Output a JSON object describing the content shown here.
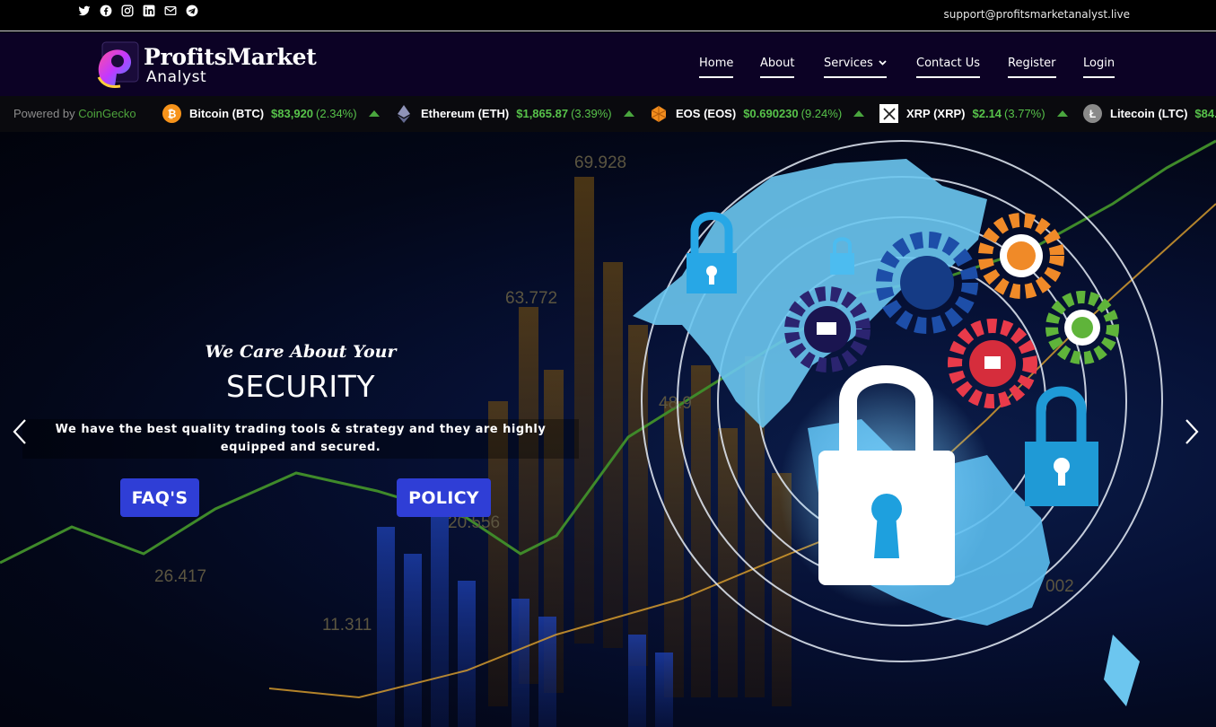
{
  "topbar": {
    "socials": [
      {
        "icon": "twitter-icon"
      },
      {
        "icon": "facebook-icon"
      },
      {
        "icon": "instagram-icon"
      },
      {
        "icon": "linkedin-icon"
      },
      {
        "icon": "mail-icon"
      },
      {
        "icon": "telegram-icon"
      }
    ],
    "email": "support@profitsmarketanalyst.live"
  },
  "header": {
    "logo_line1": "ProfitsMarket",
    "logo_line2": "Analyst",
    "nav": [
      {
        "label": "Home"
      },
      {
        "label": "About"
      },
      {
        "label": "Services"
      },
      {
        "label": "Contact Us"
      },
      {
        "label": "Register"
      },
      {
        "label": "Login"
      }
    ]
  },
  "ticker": {
    "powered_prefix": "Powered by ",
    "powered_brand": "CoinGecko",
    "coins": [
      {
        "name": "Bitcoin (BTC)",
        "price": "$83,920",
        "change": "(2.34%)",
        "color": "#f7931a"
      },
      {
        "name": "Ethereum (ETH)",
        "price": "$1,865.87",
        "change": "(3.39%)",
        "color": "#8c8c9e"
      },
      {
        "name": "EOS (EOS)",
        "price": "$0.690230",
        "change": "(9.24%)",
        "color": "#f08a1c"
      },
      {
        "name": "XRP (XRP)",
        "price": "$2.14",
        "change": "(3.77%)",
        "color": "#ffffff"
      },
      {
        "name": "Litecoin (LTC)",
        "price": "$84.",
        "change": "",
        "color": "#8a8a8a"
      }
    ]
  },
  "hero": {
    "subtitle": "We Care About Your",
    "title": "SECURITY",
    "text": "We have the best quality trading tools & strategy and they are highly equipped and secured.",
    "faq_button": "FAQ'S",
    "policy_button": "POLICY",
    "chart_numbers": [
      "69.928",
      "63.772",
      "48.9",
      "20.556",
      "26.417",
      "11.311",
      "002"
    ]
  }
}
